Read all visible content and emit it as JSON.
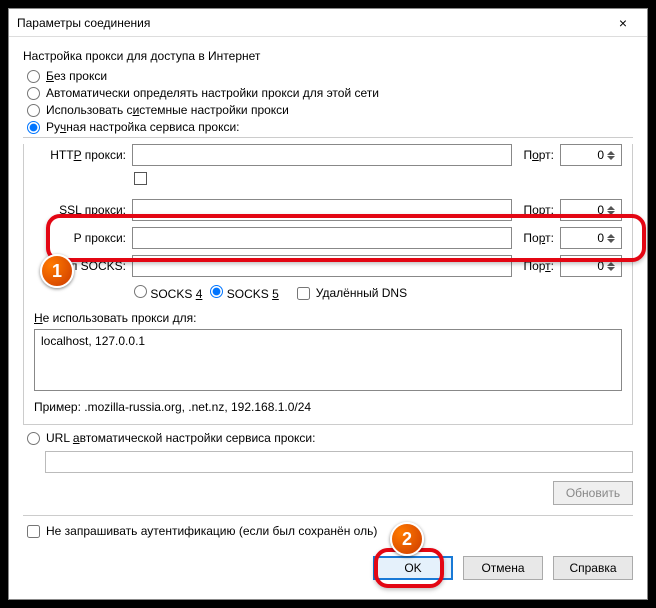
{
  "window": {
    "title": "Параметры соединения",
    "close_label": "×"
  },
  "legend": "Настройка прокси для доступа в Интернет",
  "radios": {
    "no_proxy": "Без прокси",
    "auto_detect": "Автоматически определять настройки прокси для этой сети",
    "system": "Использовать системные настройки прокси",
    "manual": "Ручная настройка сервиса прокси:",
    "url_auto": "URL автоматической настройки сервиса прокси:"
  },
  "proxy": {
    "http_label": "HTTP прокси:",
    "ssl_label": "SSL прокси:",
    "ftp_label": "P прокси:",
    "socks_node_label": "Узел SOCKS:",
    "port_label": "Порт:",
    "http_port": "0",
    "ssl_port": "0",
    "ftp_port": "0",
    "socks_port": "0",
    "same_for_all": "",
    "socks4": "SOCKS 4",
    "socks5": "SOCKS 5",
    "remote_dns": "Удалённый DNS"
  },
  "noproxy": {
    "label": "Не использовать прокси для:",
    "value": "localhost, 127.0.0.1",
    "example": "Пример: .mozilla-russia.org, .net.nz, 192.168.1.0/24"
  },
  "refresh": "Обновить",
  "auth_checkbox": "Не запрашивать аутентификацию (если был сохранён        оль)",
  "buttons": {
    "ok": "OK",
    "cancel": "Отмена",
    "help": "Справка"
  }
}
